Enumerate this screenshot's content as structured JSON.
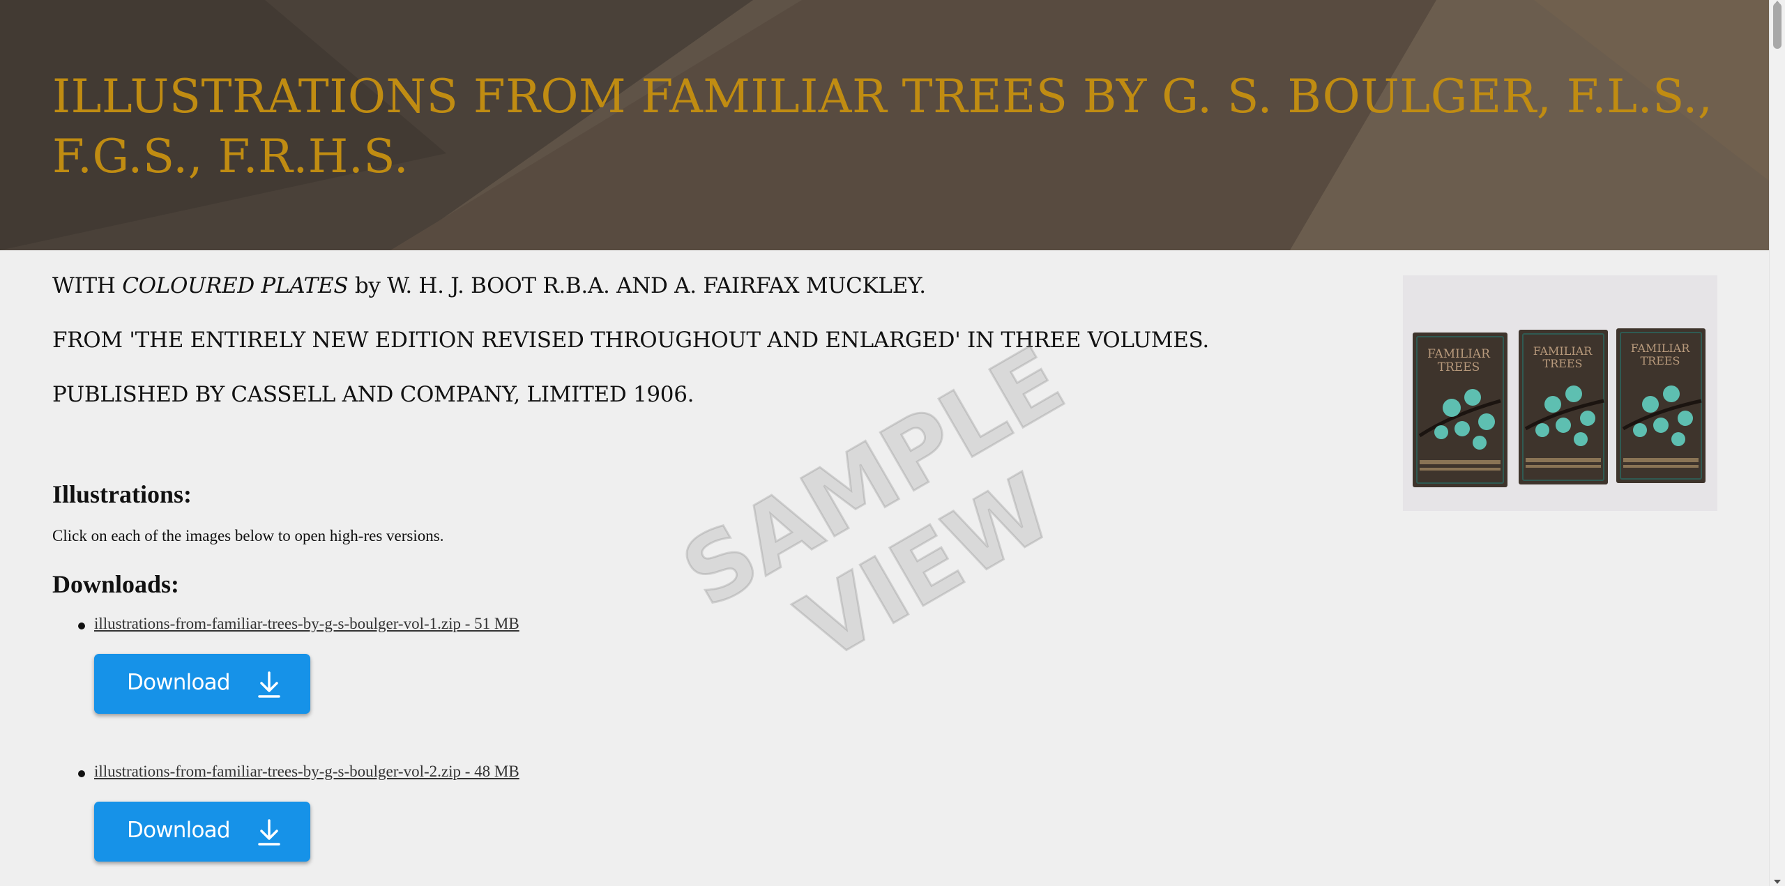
{
  "header": {
    "title": "ILLUSTRATIONS FROM FAMILIAR TREES BY G. S. BOULGER, F.L.S., F.G.S., F.R.H.S."
  },
  "intro": {
    "line1_prefix": "WITH ",
    "line1_italic": "COLOURED PLATES",
    "line1_suffix": " by W. H. J. BOOT R.B.A. AND A. FAIRFAX MUCKLEY.",
    "line2": "FROM 'THE ENTIRELY NEW EDITION REVISED THROUGHOUT AND ENLARGED' IN THREE VOLUMES.",
    "line3": "PUBLISHED BY CASSELL AND COMPANY, LIMITED 1906."
  },
  "cover_image": {
    "book_title_line1": "FAMILIAR",
    "book_title_line2": "TREES"
  },
  "illustrations": {
    "heading": "Illustrations:",
    "note": "Click on each of the images below to open high-res versions."
  },
  "downloads": {
    "heading": "Downloads:",
    "items": [
      {
        "file": "illustrations-from-familiar-trees-by-g-s-boulger-vol-1.zip - 51 MB",
        "button_label": "Download"
      },
      {
        "file": "illustrations-from-familiar-trees-by-g-s-boulger-vol-2.zip - 48 MB",
        "button_label": "Download"
      }
    ]
  },
  "watermark": {
    "line1": "SAMPLE",
    "line2": "VIEW"
  },
  "colors": {
    "banner": "#5f5347",
    "title": "#c08c12",
    "button": "#1692e8",
    "background": "#efefef"
  }
}
